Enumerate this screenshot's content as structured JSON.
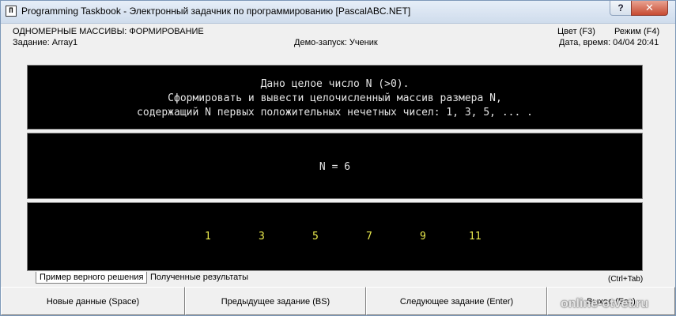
{
  "window": {
    "icon_glyph": "Π",
    "title": "Programming Taskbook - Электронный задачник по программированию [PascalABC.NET]",
    "help_label": "?",
    "close_label": "✕"
  },
  "header": {
    "topic": "ОДНОМЕРНЫЕ МАССИВЫ: ФОРМИРОВАНИЕ",
    "color_label": "Цвет (F3)",
    "mode_label": "Режим (F4)",
    "task": "Задание: Array1",
    "demo": "Демо-запуск: Ученик",
    "datetime": "Дата, время: 04/04 20:41"
  },
  "task_text": [
    "Дано целое число N (>0).",
    "Сформировать и вывести целочисленный массив размера N,",
    "содержащий N первых положительных нечетных чисел: 1, 3, 5, ... ."
  ],
  "input_data": "N = 6",
  "output_data": [
    "1",
    "3",
    "5",
    "7",
    "9",
    "11"
  ],
  "tabs": {
    "active": "Пример верного решения",
    "inactive": "Полученные результаты",
    "hint": "(Ctrl+Tab)"
  },
  "buttons": {
    "new_data": "Новые данные (Space)",
    "prev_task": "Предыдущее задание (BS)",
    "next_task": "Следующее задание (Enter)",
    "exit": "Выход (Esc)"
  },
  "watermark": "online-otvet.ru",
  "colors": {
    "panel_bg": "#000000",
    "task_text": "#e4e4e4",
    "output_text": "#ecec4e"
  }
}
